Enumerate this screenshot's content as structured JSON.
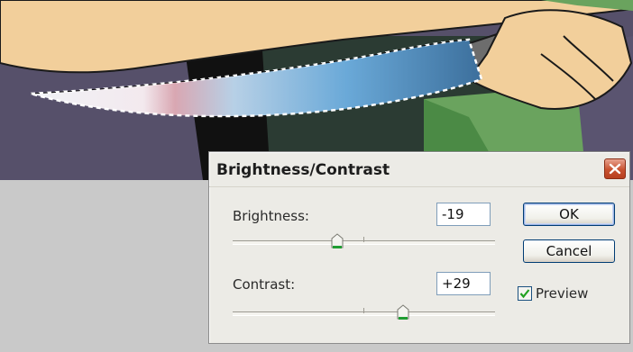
{
  "dialog": {
    "title": "Brightness/Contrast",
    "close_icon": "close-x-icon",
    "brightness": {
      "label": "Brightness:",
      "value": "-19",
      "slider_fraction": 0.4
    },
    "contrast": {
      "label": "Contrast:",
      "value": "+29",
      "slider_fraction": 0.65
    },
    "ok_label": "OK",
    "cancel_label": "Cancel",
    "preview_label": "Preview",
    "preview_checked": true
  },
  "colors": {
    "dialog_bg": "#ecebe6",
    "close_button": "#c8512f",
    "thumb_accent": "#1f9d32",
    "canvas_gray": "#c9c9c9"
  }
}
